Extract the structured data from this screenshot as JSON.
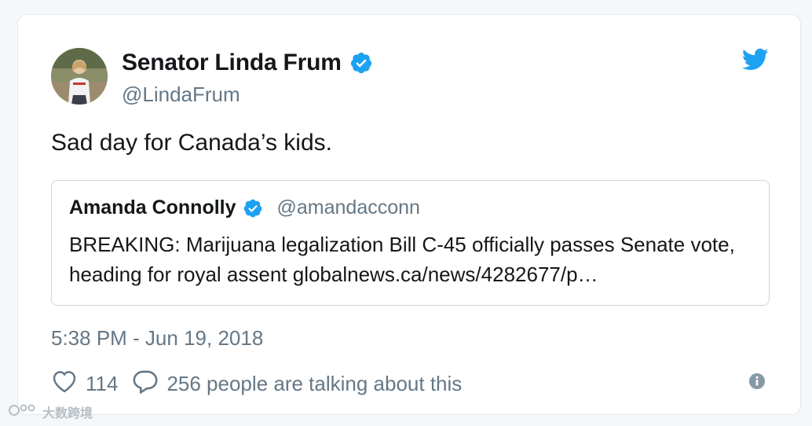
{
  "tweet": {
    "author_name": "Senator Linda Frum",
    "author_handle": "@LindaFrum",
    "text": "Sad day for Canada’s kids.",
    "timestamp": "5:38 PM - Jun 19, 2018",
    "likes": "114",
    "conversation": "256 people are talking about this"
  },
  "quote": {
    "author_name": "Amanda Connolly",
    "author_handle": "@amandacconn",
    "text": "BREAKING: Marijuana legalization Bill C-45 officially passes Senate vote, heading for royal assent  globalnews.ca/news/4282677/p…"
  },
  "watermark": {
    "text": "大数跨境"
  },
  "colors": {
    "twitter_blue": "#1da1f2",
    "text_primary": "#14171a",
    "text_secondary": "#657786",
    "border": "#e1e8ed"
  },
  "icons": {
    "brand": "twitter-bird-icon",
    "verified": "verified-badge-icon",
    "like": "heart-icon",
    "reply": "speech-bubble-icon",
    "info": "info-icon"
  }
}
